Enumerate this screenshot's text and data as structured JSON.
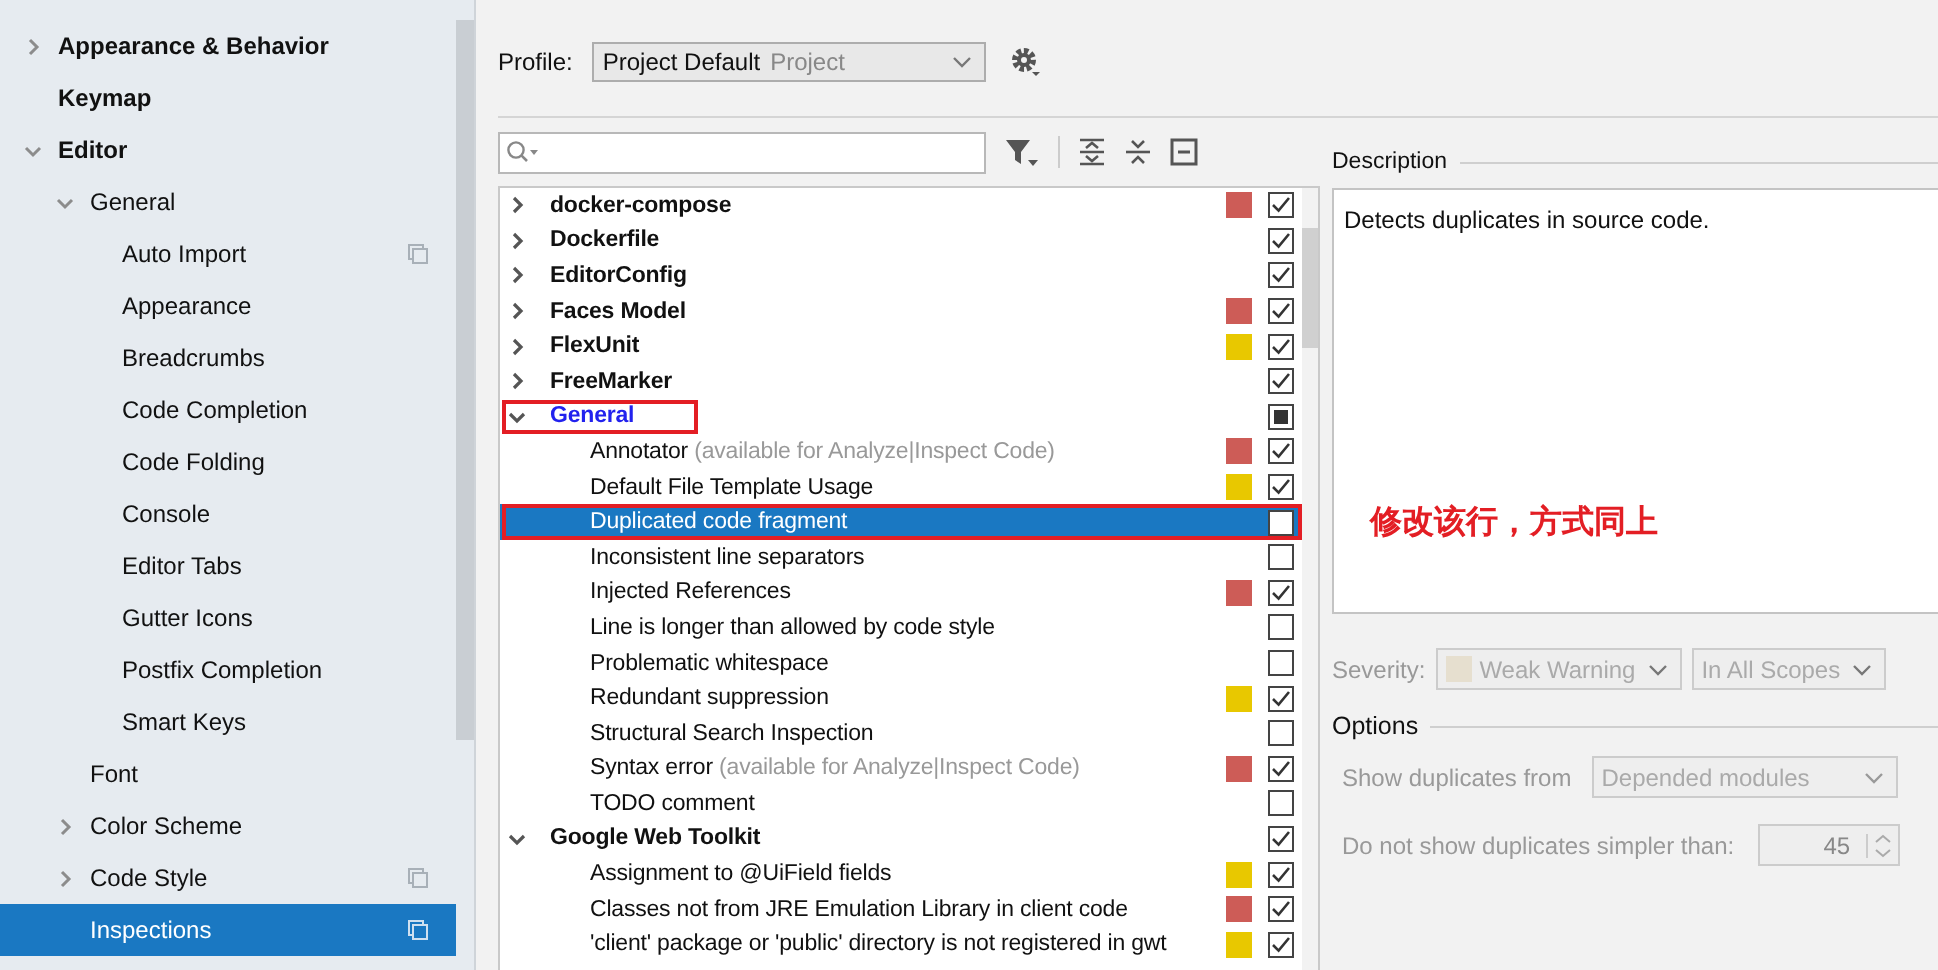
{
  "sidebar": {
    "items": [
      {
        "label": "Appearance & Behavior",
        "bold": true,
        "expanded": false,
        "selected": false
      },
      {
        "label": "Keymap",
        "bold": true,
        "selected": false
      },
      {
        "label": "Editor",
        "bold": true,
        "expanded": true,
        "selected": false,
        "children": [
          {
            "label": "General",
            "bold": false,
            "expanded": true,
            "selected": false,
            "children": [
              {
                "label": "Auto Import",
                "bold": false,
                "selected": false,
                "project_icon": true
              },
              {
                "label": "Appearance",
                "bold": false,
                "selected": false
              },
              {
                "label": "Breadcrumbs",
                "bold": false,
                "selected": false
              },
              {
                "label": "Code Completion",
                "bold": false,
                "selected": false
              },
              {
                "label": "Code Folding",
                "bold": false,
                "selected": false
              },
              {
                "label": "Console",
                "bold": false,
                "selected": false
              },
              {
                "label": "Editor Tabs",
                "bold": false,
                "selected": false
              },
              {
                "label": "Gutter Icons",
                "bold": false,
                "selected": false
              },
              {
                "label": "Postfix Completion",
                "bold": false,
                "selected": false
              },
              {
                "label": "Smart Keys",
                "bold": false,
                "selected": false
              }
            ]
          },
          {
            "label": "Font",
            "bold": false,
            "selected": false
          },
          {
            "label": "Color Scheme",
            "bold": false,
            "expanded": false,
            "selected": false
          },
          {
            "label": "Code Style",
            "bold": false,
            "expanded": false,
            "selected": false,
            "project_icon": true
          },
          {
            "label": "Inspections",
            "bold": false,
            "selected": true,
            "project_icon": true
          }
        ]
      }
    ]
  },
  "profile": {
    "label": "Profile:",
    "value": "Project Default",
    "scope": "Project"
  },
  "inspections": {
    "groups": [
      {
        "name": "docker-compose",
        "expanded": false,
        "checked": true,
        "selected": false,
        "color": "#cd5c57"
      },
      {
        "name": "Dockerfile",
        "expanded": false,
        "checked": true,
        "selected": false
      },
      {
        "name": "EditorConfig",
        "expanded": false,
        "checked": true,
        "selected": false
      },
      {
        "name": "Faces Model",
        "expanded": false,
        "checked": true,
        "selected": false,
        "color": "#cd5c57"
      },
      {
        "name": "FlexUnit",
        "expanded": false,
        "checked": true,
        "selected": false,
        "color": "#e8c800"
      },
      {
        "name": "FreeMarker",
        "expanded": false,
        "checked": true,
        "selected": false
      },
      {
        "name": "General",
        "expanded": true,
        "checked": false,
        "partial": true,
        "selected": false,
        "annotated": true,
        "children": [
          {
            "name": "Annotator",
            "note": "(available for Analyze|Inspect Code)",
            "checked": true,
            "selected": false,
            "color": "#cd5c57"
          },
          {
            "name": "Default File Template Usage",
            "checked": true,
            "selected": false,
            "color": "#e8c800"
          },
          {
            "name": "Duplicated code fragment",
            "checked": false,
            "selected": true,
            "annotated": true
          },
          {
            "name": "Inconsistent line separators",
            "checked": false,
            "selected": false
          },
          {
            "name": "Injected References",
            "checked": true,
            "selected": false,
            "color": "#cd5c57"
          },
          {
            "name": "Line is longer than allowed by code style",
            "checked": false,
            "selected": false
          },
          {
            "name": "Problematic whitespace",
            "checked": false,
            "selected": false
          },
          {
            "name": "Redundant suppression",
            "checked": true,
            "selected": false,
            "color": "#e8c800"
          },
          {
            "name": "Structural Search Inspection",
            "checked": false,
            "selected": false
          },
          {
            "name": "Syntax error",
            "note": "(available for Analyze|Inspect Code)",
            "checked": true,
            "selected": false,
            "color": "#cd5c57"
          },
          {
            "name": "TODO comment",
            "checked": false,
            "selected": false
          }
        ]
      },
      {
        "name": "Google Web Toolkit",
        "expanded": true,
        "checked": true,
        "selected": false,
        "children": [
          {
            "name": "Assignment to @UiField fields",
            "checked": true,
            "selected": false,
            "color": "#e8c800"
          },
          {
            "name": "Classes not from JRE Emulation Library in client code",
            "checked": true,
            "selected": false,
            "color": "#cd5c57"
          },
          {
            "name": "'client' package or 'public' directory is not registered in gwt",
            "checked": true,
            "selected": false,
            "color": "#e8c800"
          }
        ]
      }
    ]
  },
  "description": {
    "title": "Description",
    "text": "Detects duplicates in source code."
  },
  "severity": {
    "label": "Severity:",
    "value": "Weak Warning",
    "scope": "In All Scopes",
    "disabled": true
  },
  "options": {
    "title": "Options",
    "show_from_label": "Show duplicates from",
    "show_from_value": "Depended modules",
    "simpler_label": "Do not show duplicates simpler than:",
    "simpler_value": "45",
    "disabled": true
  },
  "annotation": {
    "text": "修改该行，方式同上"
  }
}
